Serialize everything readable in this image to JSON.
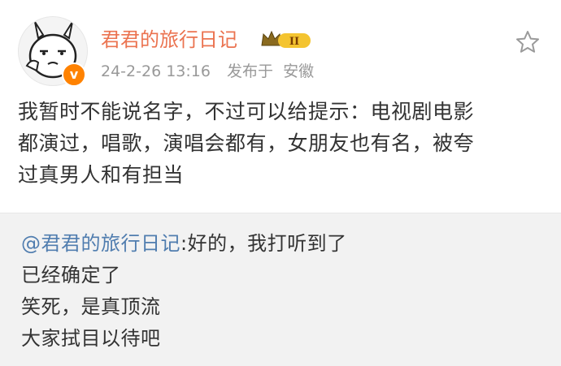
{
  "post": {
    "author": "君君的旅行日记",
    "badge_level": "II",
    "timestamp": "24-2-26 13:16",
    "location_prefix": "发布于",
    "location": "安徽",
    "verified_mark": "v",
    "text_lines": [
      "我暂时不能说名字，不过可以给提示：电视剧电影",
      "都演过，唱歌，演唱会都有，女朋友也有名，被夸",
      "过真男人和有担当"
    ]
  },
  "repost": {
    "mention": "@君君的旅行日记",
    "first_line_rest": ":好的，我打听到了",
    "lines": [
      "已经确定了",
      "笑死，是真顶流",
      "大家拭目以待吧"
    ]
  },
  "colors": {
    "username": "#eb7350",
    "mention": "#507daf",
    "meta": "#999999",
    "verified": "#ff8200",
    "repost_bg": "#f2f2f2"
  }
}
